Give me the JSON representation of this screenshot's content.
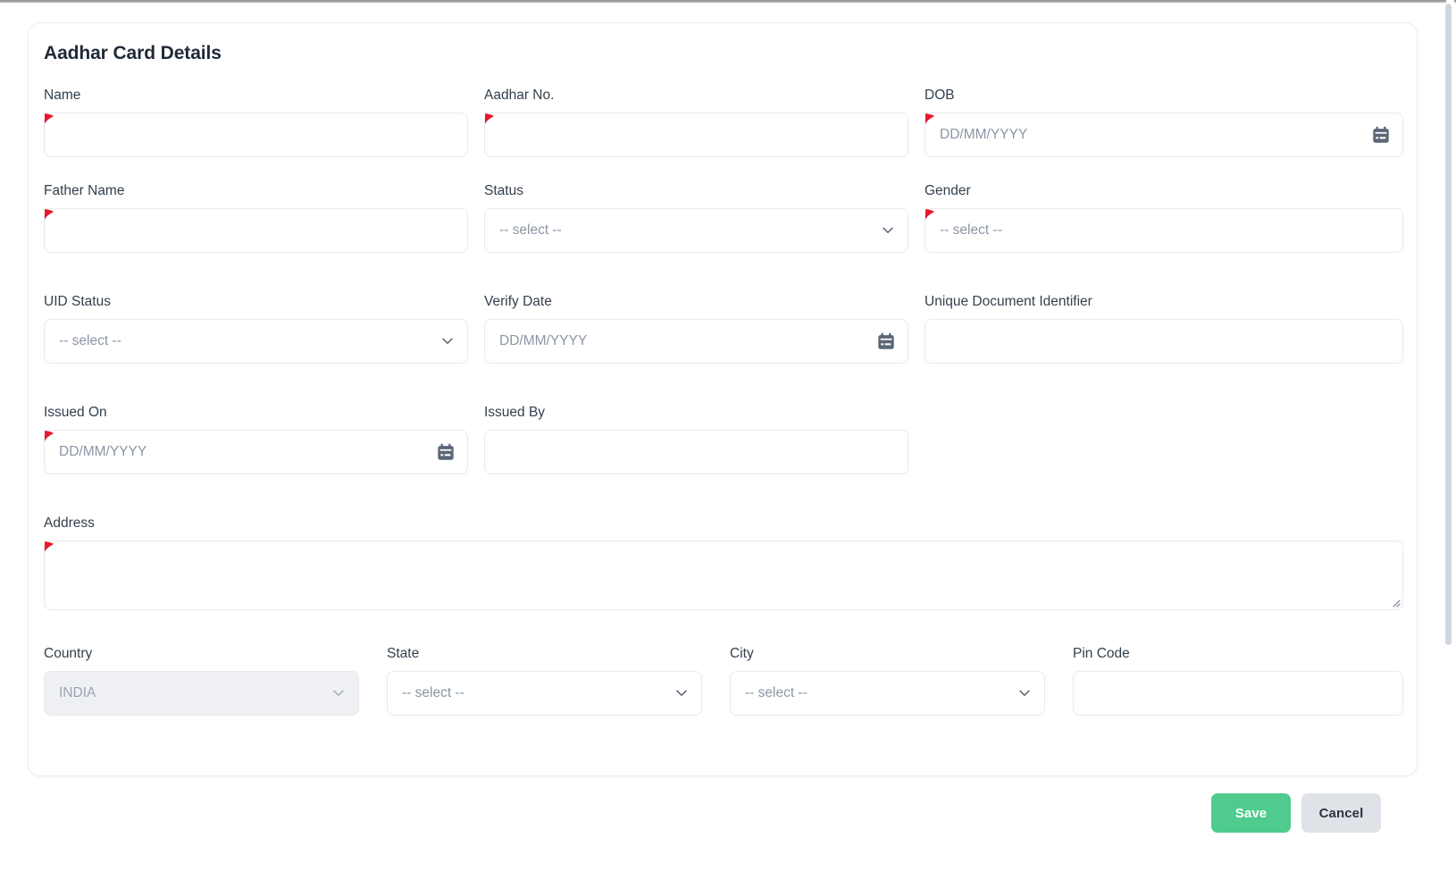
{
  "card": {
    "title": "Aadhar Card Details"
  },
  "fields": {
    "name": {
      "label": "Name",
      "value": "",
      "placeholder": "",
      "required": true,
      "type": "text"
    },
    "aadhar_no": {
      "label": "Aadhar No.",
      "value": "",
      "placeholder": "",
      "required": true,
      "type": "text"
    },
    "dob": {
      "label": "DOB",
      "value": "",
      "placeholder": "DD/MM/YYYY",
      "required": true,
      "type": "date"
    },
    "father_name": {
      "label": "Father Name",
      "value": "",
      "placeholder": "",
      "required": true,
      "type": "text"
    },
    "status": {
      "label": "Status",
      "value": "-- select --",
      "required": false,
      "type": "select"
    },
    "gender": {
      "label": "Gender",
      "value": "-- select --",
      "required": true,
      "type": "select"
    },
    "uid_status": {
      "label": "UID Status",
      "value": "-- select --",
      "required": false,
      "type": "select"
    },
    "verify_date": {
      "label": "Verify Date",
      "value": "",
      "placeholder": "DD/MM/YYYY",
      "required": false,
      "type": "date"
    },
    "udi": {
      "label": "Unique Document Identifier",
      "value": "",
      "placeholder": "",
      "required": false,
      "type": "text"
    },
    "issued_on": {
      "label": "Issued On",
      "value": "",
      "placeholder": "DD/MM/YYYY",
      "required": true,
      "type": "date"
    },
    "issued_by": {
      "label": "Issued By",
      "value": "",
      "placeholder": "",
      "required": false,
      "type": "text"
    },
    "address": {
      "label": "Address",
      "value": "",
      "placeholder": "",
      "required": true,
      "type": "textarea"
    },
    "country": {
      "label": "Country",
      "value": "INDIA",
      "required": false,
      "type": "select",
      "disabled": true
    },
    "state": {
      "label": "State",
      "value": "-- select --",
      "required": false,
      "type": "select"
    },
    "city": {
      "label": "City",
      "value": "-- select --",
      "required": false,
      "type": "select"
    },
    "pin_code": {
      "label": "Pin Code",
      "value": "",
      "placeholder": "",
      "required": false,
      "type": "text"
    }
  },
  "footer": {
    "save_label": "Save",
    "cancel_label": "Cancel"
  },
  "colors": {
    "required_marker": "#e8192c",
    "save_button": "#4ecb8d",
    "cancel_button": "#dfe3e8",
    "label_text": "#33404e",
    "placeholder_text": "#8b96a5",
    "border": "#e6e9ee",
    "title_text": "#1f2a37",
    "disabled_bg": "#eef0f3"
  },
  "icons": {
    "calendar": "calendar-icon",
    "chevron_down": "chevron-down-icon",
    "resize_grip": "resize-grip-icon"
  }
}
